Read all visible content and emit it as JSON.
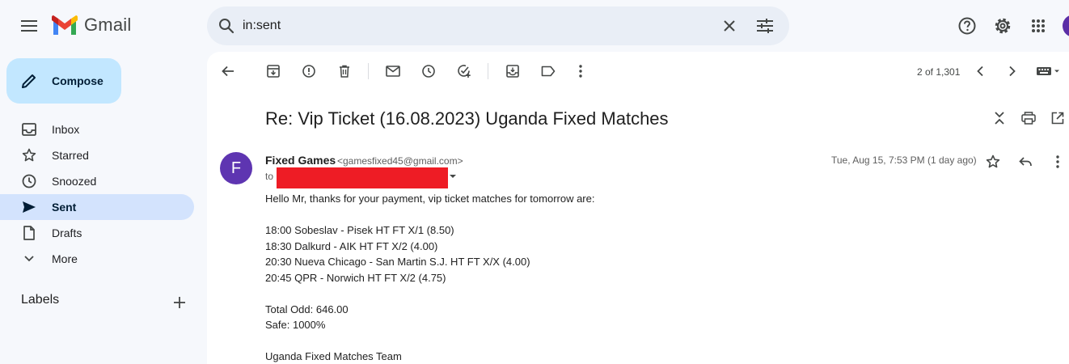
{
  "header": {
    "app_name": "Gmail",
    "search": {
      "value": "in:sent",
      "placeholder": "Search mail"
    }
  },
  "sidebar": {
    "compose_label": "Compose",
    "items": [
      {
        "label": "Inbox",
        "icon": "inbox-icon"
      },
      {
        "label": "Starred",
        "icon": "star-icon"
      },
      {
        "label": "Snoozed",
        "icon": "clock-icon"
      },
      {
        "label": "Sent",
        "icon": "send-icon",
        "active": true
      },
      {
        "label": "Drafts",
        "icon": "draft-icon"
      },
      {
        "label": "More",
        "icon": "chevron-down-icon"
      }
    ],
    "labels_title": "Labels"
  },
  "toolbar": {
    "pager": "2 of 1,301"
  },
  "email": {
    "subject": "Re: Vip Ticket (16.08.2023) Uganda Fixed Matches",
    "sender_initial": "F",
    "sender_name": "Fixed Games",
    "sender_email": "<gamesfixed45@gmail.com>",
    "to_label": "to",
    "date": "Tue, Aug 15, 7:53 PM (1 day ago)",
    "body": [
      "Hello Mr, thanks for your payment, vip ticket matches for tomorrow are:",
      "18:00 Sobeslav - Pisek HT FT X/1 (8.50)",
      "18:30 Dalkurd - AIK HT FT X/2 (4.00)",
      "20:30 Nueva Chicago - San Martin S.J. HT FT X/X (4.00)",
      "20:45 QPR - Norwich HT FT X/2 (4.75)",
      "Total Odd: 646.00",
      "Safe: 1000%",
      "Uganda Fixed Matches Team"
    ]
  },
  "colors": {
    "accent": "#0b57d0",
    "compose_bg": "#c2e7ff",
    "active_nav": "#d3e3fd",
    "redaction": "#ee1c25",
    "avatar": "#5e35b1"
  }
}
